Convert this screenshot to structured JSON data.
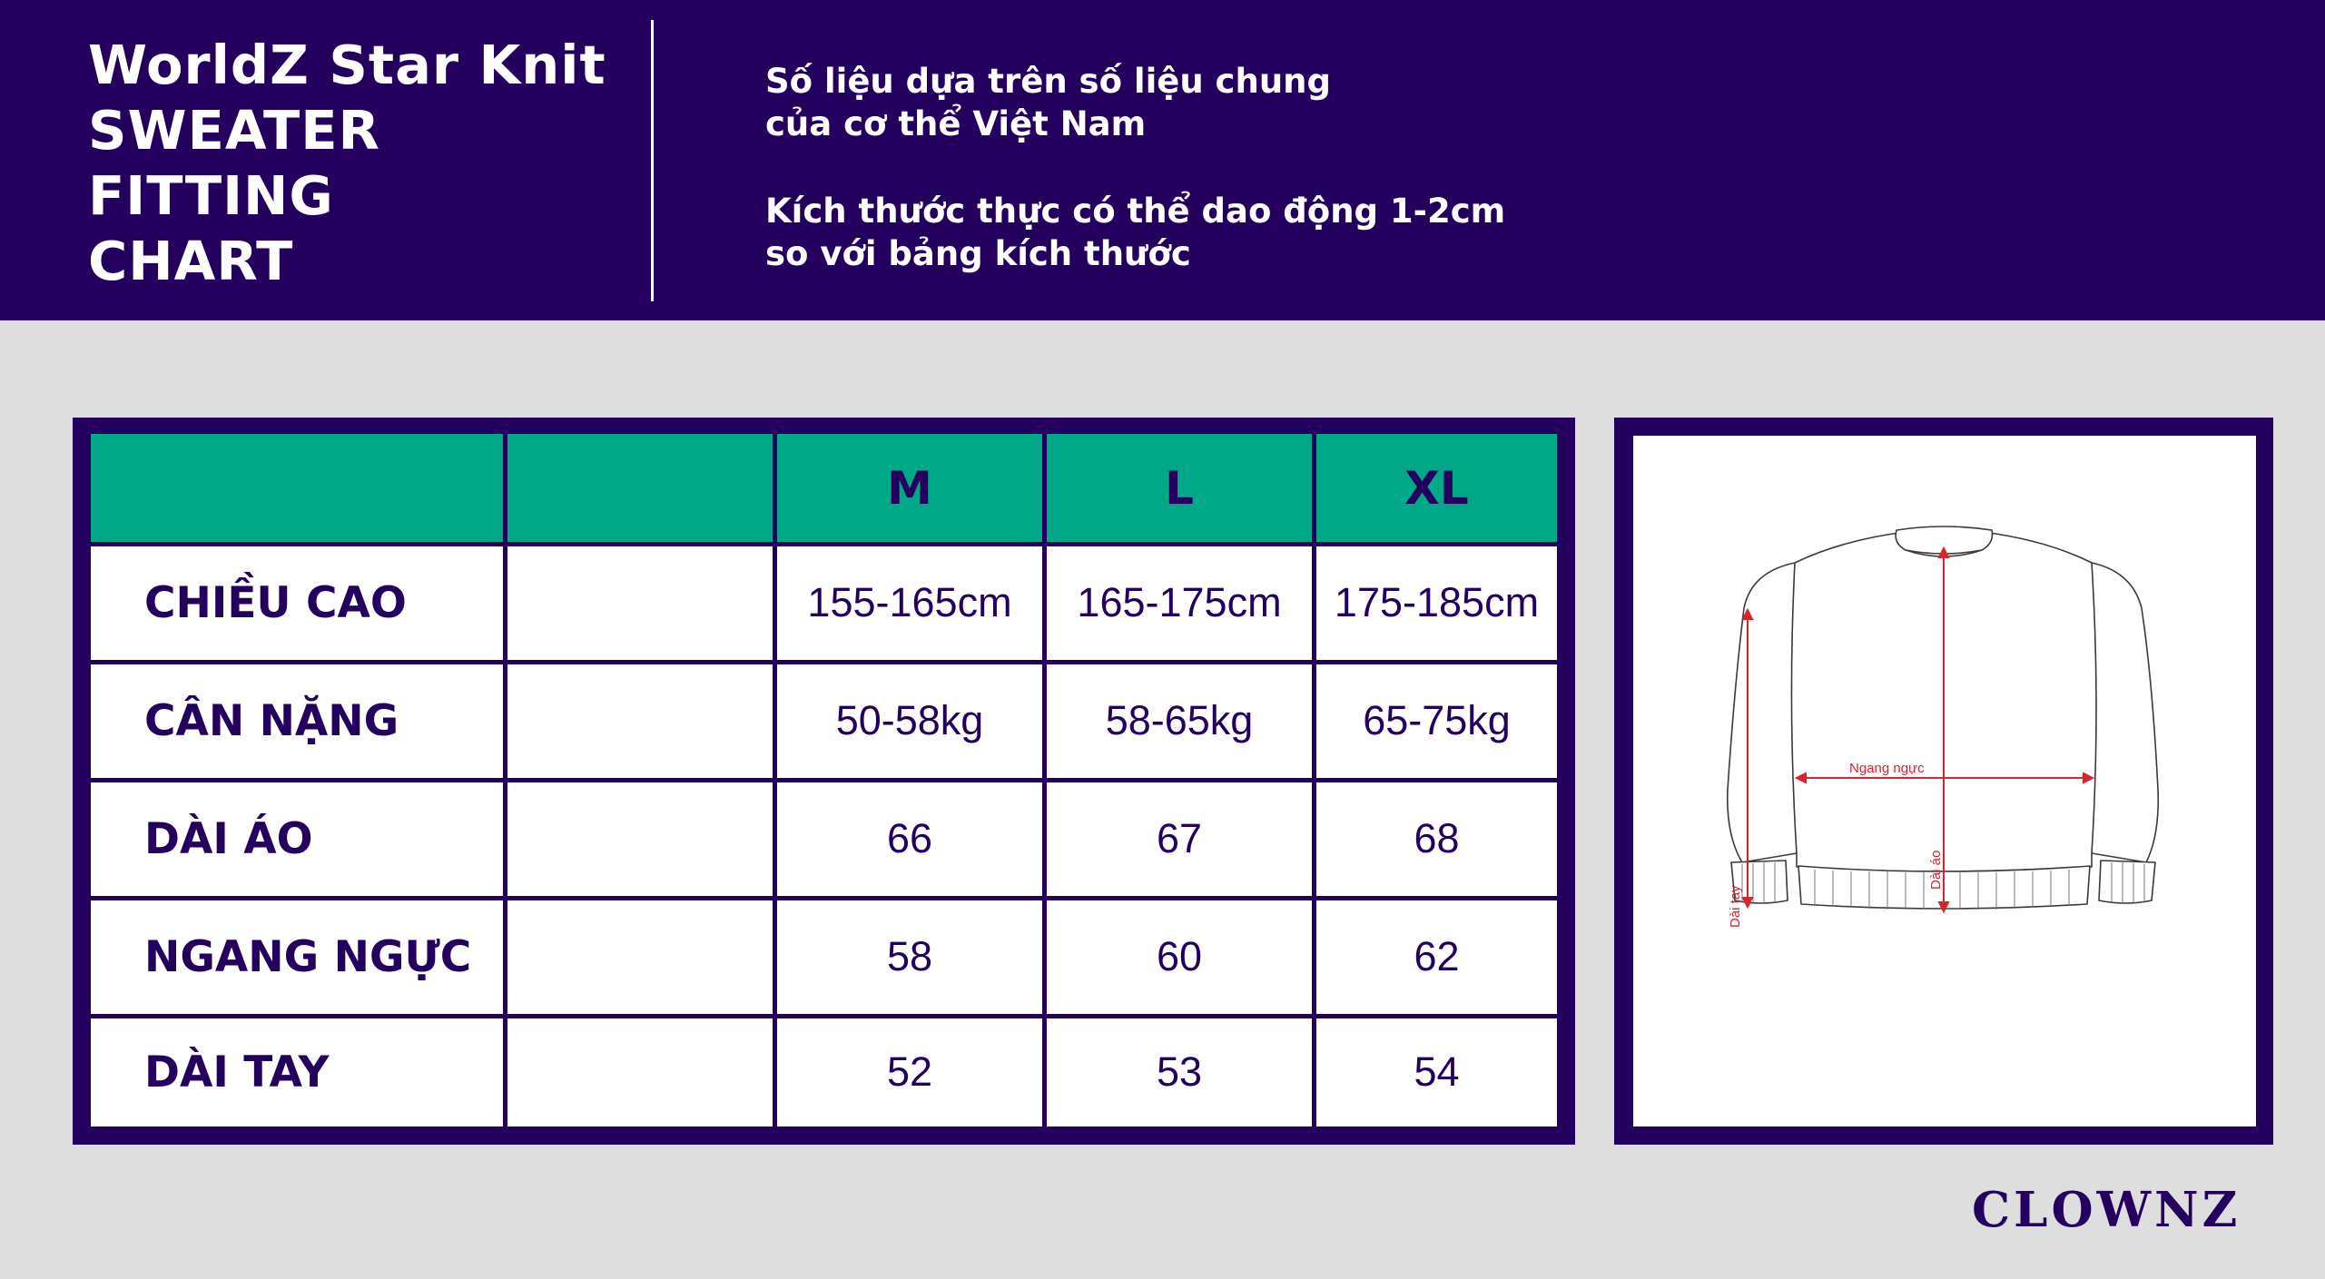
{
  "header": {
    "title_lines": [
      "WorldZ Star Knit",
      "SWEATER",
      "FITTING",
      "CHART"
    ],
    "note_1": [
      "Số liệu dựa trên số liệu chung",
      "của cơ thể Việt Nam"
    ],
    "note_2": [
      "Kích thước thực có thể dao động 1-2cm",
      "so với bảng kích thước"
    ]
  },
  "size_table": {
    "headers": [
      "",
      "",
      "M",
      "L",
      "XL"
    ],
    "rows": [
      {
        "label": "CHIỀU CAO",
        "values": [
          "155-165cm",
          "165-175cm",
          "175-185cm"
        ]
      },
      {
        "label": "CÂN NẶNG",
        "values": [
          "50-58kg",
          "58-65kg",
          "65-75kg"
        ]
      },
      {
        "label": "DÀI ÁO",
        "values": [
          "66",
          "67",
          "68"
        ]
      },
      {
        "label": "NGANG NGỰC",
        "values": [
          "58",
          "60",
          "62"
        ]
      },
      {
        "label": "DÀI TAY",
        "values": [
          "52",
          "53",
          "54"
        ]
      }
    ]
  },
  "diagram": {
    "chest_label": "Ngang ngực",
    "length_label": "Dài áo",
    "sleeve_label": "Dài tay",
    "measure_color": "#d9232d"
  },
  "brand": "CLOWNZ",
  "colors": {
    "primary": "#23005e",
    "accent": "#00a888",
    "background": "#dedede"
  }
}
